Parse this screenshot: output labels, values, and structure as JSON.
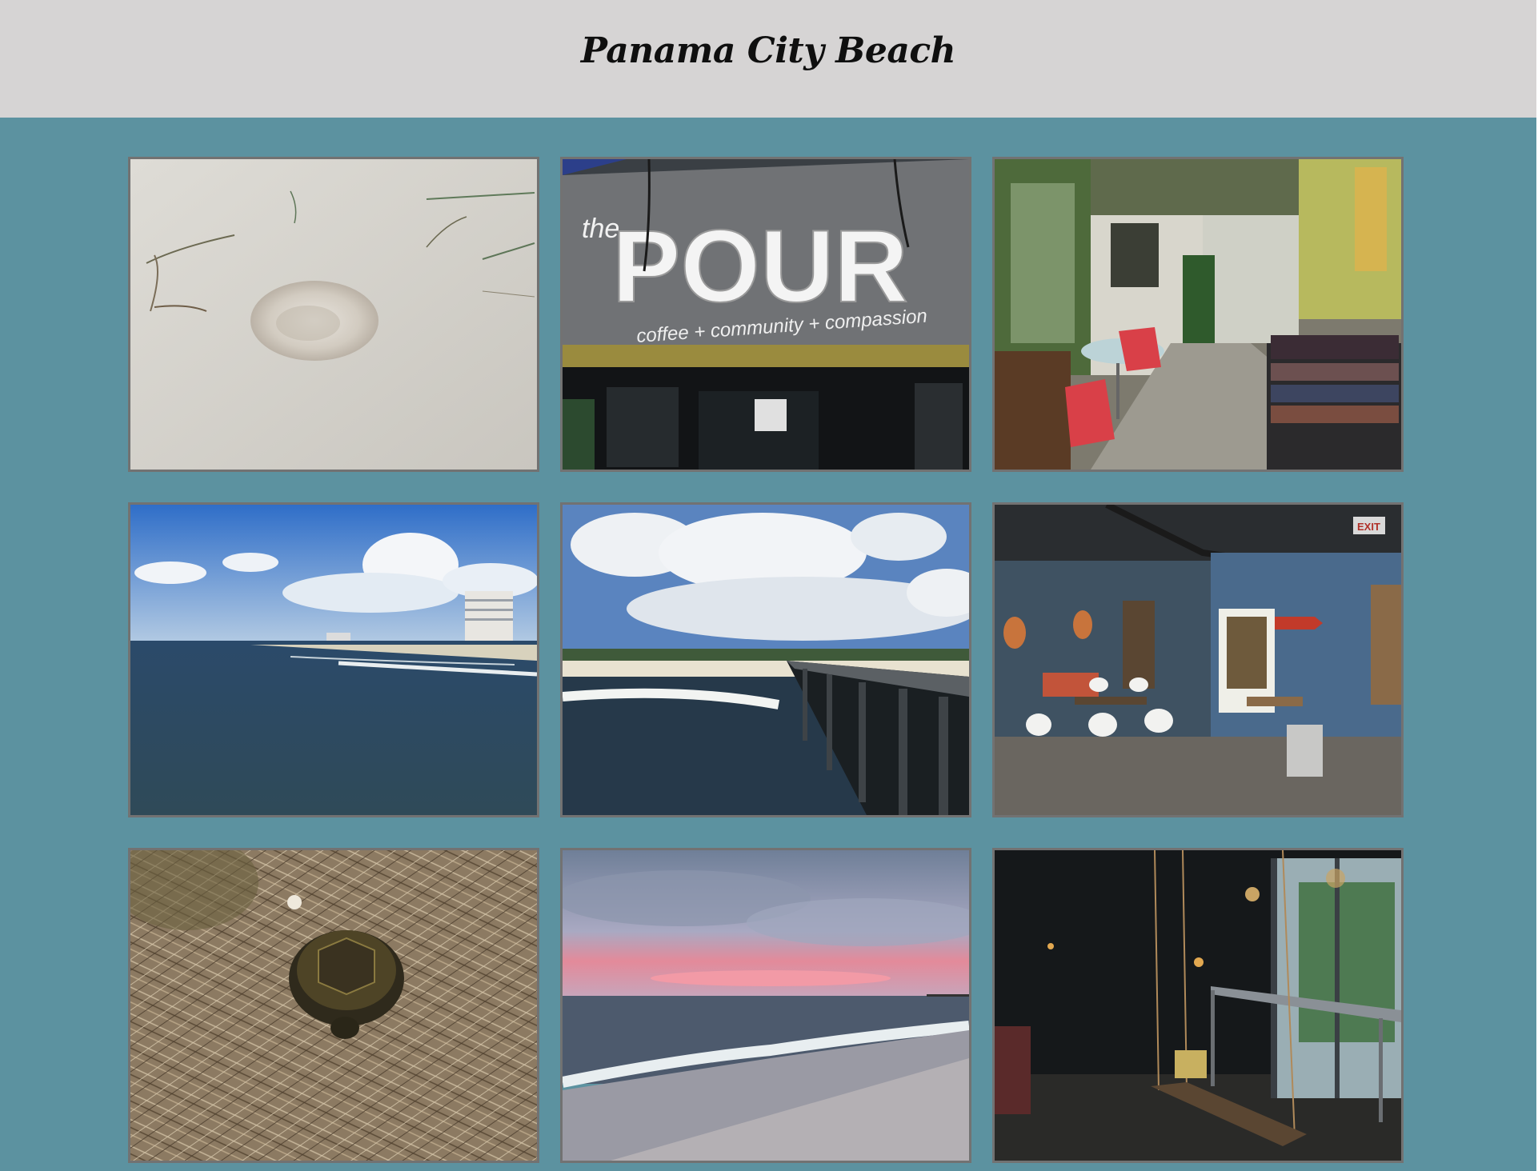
{
  "header": {
    "title": "Panama City Beach"
  },
  "gallery": {
    "photos": [
      {
        "subject": "jellyfish-on-sand"
      },
      {
        "subject": "the-pour-storefront-sign",
        "sign": {
          "small": "the",
          "big": "POUR",
          "tagline": "coffee + community + compassion"
        }
      },
      {
        "subject": "coffee-shop-patio"
      },
      {
        "subject": "gulf-shoreline-with-hotels"
      },
      {
        "subject": "fishing-pier-and-beach"
      },
      {
        "subject": "coffee-shop-interior",
        "exit_sign": "EXIT"
      },
      {
        "subject": "turtle-in-pine-straw"
      },
      {
        "subject": "sunset-over-gulf"
      },
      {
        "subject": "dark-lounge-with-swing"
      }
    ]
  },
  "colors": {
    "page_background": "#5c92a0",
    "header_background": "#d6d4d4",
    "title_text": "#0f0f0f",
    "photo_border": "#727272"
  }
}
